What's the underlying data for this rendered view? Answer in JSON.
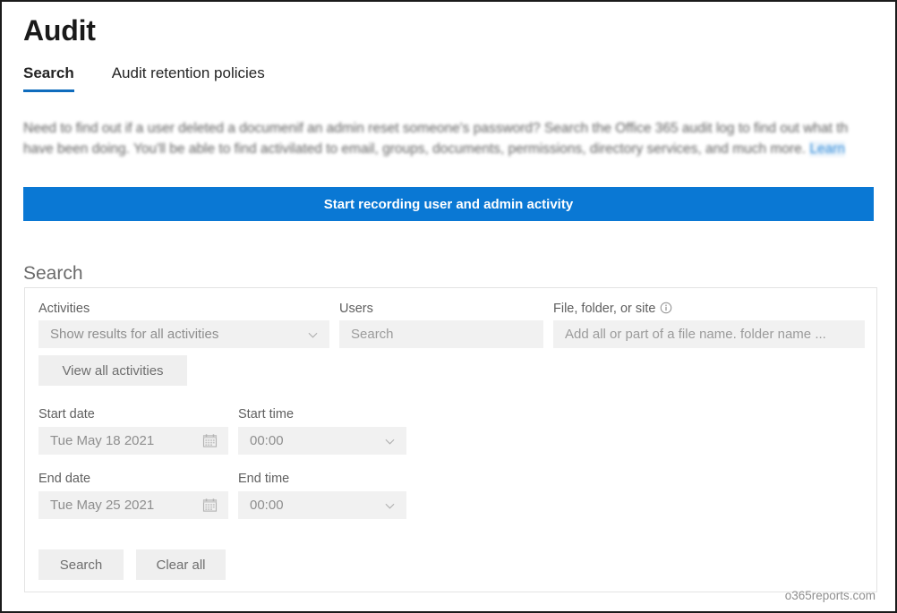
{
  "page": {
    "title": "Audit",
    "watermark": "o365reports.com"
  },
  "tabs": [
    {
      "label": "Search",
      "active": true
    },
    {
      "label": "Audit retention policies",
      "active": false
    }
  ],
  "description": {
    "line1": "Need to find out if a user deleted a documenif an admin reset someone's password? Search the Office 365 audit log to find out what th",
    "line2": "have been doing. You'll be able to find activilated to email, groups, documents, permissions, directory services, and much more.",
    "link": "Learn"
  },
  "banner": {
    "label": "Start recording user and admin activity",
    "color": "#0a78d4"
  },
  "search_section": {
    "title": "Search",
    "fields": {
      "activities": {
        "label": "Activities",
        "value": "Show results for all activities",
        "icon": "chevron-down-icon"
      },
      "users": {
        "label": "Users",
        "placeholder": "Search"
      },
      "file_folder_site": {
        "label": "File, folder, or site",
        "info_icon": "info-icon",
        "placeholder": "Add all or part of a file name. folder name ..."
      },
      "view_all_activities": {
        "label": "View all activities"
      },
      "start_date": {
        "label": "Start date",
        "value": "Tue May 18 2021",
        "icon": "calendar-icon"
      },
      "start_time": {
        "label": "Start time",
        "value": "00:00",
        "icon": "chevron-down-icon"
      },
      "end_date": {
        "label": "End date",
        "value": "Tue May 25 2021",
        "icon": "calendar-icon"
      },
      "end_time": {
        "label": "End time",
        "value": "00:00",
        "icon": "chevron-down-icon"
      }
    },
    "actions": {
      "search": "Search",
      "clear_all": "Clear all"
    }
  }
}
